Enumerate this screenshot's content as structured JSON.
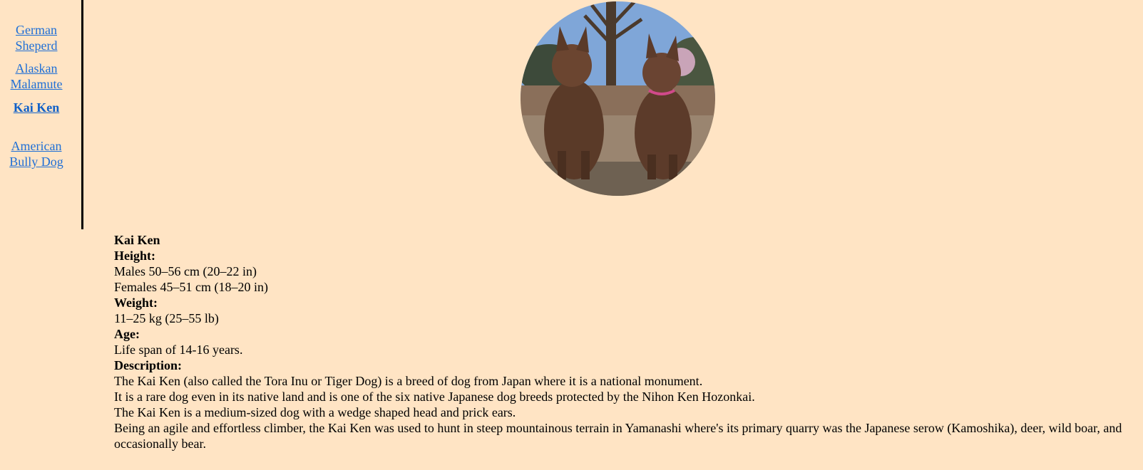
{
  "nav": {
    "items": [
      {
        "label": "German Sheperd",
        "active": false
      },
      {
        "label": "Alaskan Malamute",
        "active": false
      },
      {
        "label": "Kai Ken",
        "active": true
      },
      {
        "label": "American Bully Dog",
        "active": false
      }
    ]
  },
  "hero": {
    "image_description": "photo-of-two-brindle-dogs-sitting"
  },
  "breed": {
    "name": "Kai Ken",
    "height_label": "Height:",
    "height_males": "Males 50–56 cm (20–22 in)",
    "height_females": "Females 45–51 cm (18–20 in)",
    "weight_label": "Weight:",
    "weight_value": "11–25 kg (25–55 lb)",
    "age_label": "Age:",
    "age_value": "Life span of 14-16 years.",
    "description_label": "Description:",
    "description_lines": [
      "The Kai Ken (also called the Tora Inu or Tiger Dog) is a breed of dog from Japan where it is a national monument.",
      "It is a rare dog even in its native land and is one of the six native Japanese dog breeds protected by the Nihon Ken Hozonkai.",
      "The Kai Ken is a medium-sized dog with a wedge shaped head and prick ears.",
      "Being an agile and effortless climber, the Kai Ken was used to hunt in steep mountainous terrain in Yamanashi where's its primary quarry was the Japanese serow (Kamoshika), deer, wild boar, and occasionally bear."
    ]
  },
  "colors": {
    "background": "#ffe4c4",
    "link": "#1f6fd6"
  }
}
